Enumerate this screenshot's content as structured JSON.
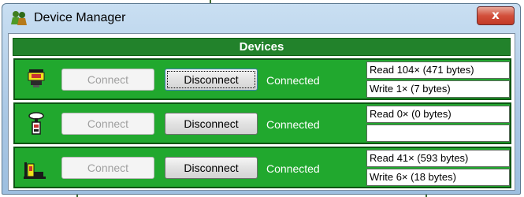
{
  "window": {
    "title": "Device Manager",
    "close_glyph": "x",
    "app_icon": "two-people-icon"
  },
  "devices_header": "Devices",
  "devices": [
    {
      "icon": "gps-receiver-icon",
      "connect_label": "Connect",
      "connect_enabled": false,
      "disconnect_label": "Disconnect",
      "disconnect_focused": true,
      "status": "Connected",
      "read": "Read 104× (471 bytes)",
      "write": "Write 1× (7 bytes)"
    },
    {
      "icon": "handheld-device-icon",
      "connect_label": "Connect",
      "connect_enabled": false,
      "disconnect_label": "Disconnect",
      "disconnect_focused": false,
      "status": "Connected",
      "read": "Read 0× (0 bytes)",
      "write": ""
    },
    {
      "icon": "machine-icon",
      "connect_label": "Connect",
      "connect_enabled": false,
      "disconnect_label": "Disconnect",
      "disconnect_focused": false,
      "status": "Connected",
      "read": "Read 41× (593 bytes)",
      "write": "Write 6× (18 bytes)"
    }
  ]
}
